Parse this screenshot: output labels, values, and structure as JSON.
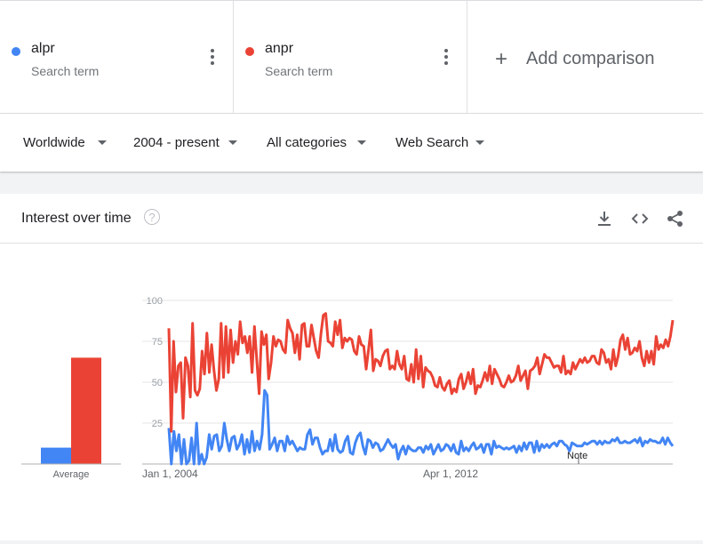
{
  "terms": [
    {
      "name": "alpr",
      "sub": "Search term",
      "color": "#4285f4"
    },
    {
      "name": "anpr",
      "sub": "Search term",
      "color": "#ea4335"
    }
  ],
  "add_comparison": "Add comparison",
  "filters": {
    "region": "Worldwide",
    "time": "2004 - present",
    "category": "All categories",
    "search_type": "Web Search"
  },
  "card": {
    "title": "Interest over time"
  },
  "chart_data": {
    "type": "line",
    "x_ticks": [
      "Jan 1, 2004",
      "Apr 1, 2012"
    ],
    "y_ticks": [
      25,
      50,
      75,
      100
    ],
    "ylim": [
      0,
      100
    ],
    "note_label": "Note",
    "average_label": "Average",
    "averages": [
      10,
      65
    ],
    "series": [
      {
        "name": "alpr",
        "color": "#4285f4",
        "values": [
          22,
          0,
          20,
          8,
          18,
          0,
          15,
          0,
          2,
          16,
          0,
          25,
          0,
          6,
          0,
          4,
          18,
          9,
          17,
          18,
          8,
          11,
          25,
          15,
          8,
          16,
          17,
          9,
          12,
          18,
          6,
          15,
          7,
          20,
          8,
          14,
          9,
          18,
          45,
          42,
          9,
          12,
          16,
          8,
          14,
          14,
          8,
          17,
          12,
          14,
          11,
          8,
          10,
          9,
          9,
          18,
          21,
          12,
          16,
          16,
          10,
          6,
          8,
          8,
          15,
          8,
          18,
          9,
          7,
          8,
          14,
          17,
          7,
          6,
          13,
          17,
          19,
          11,
          6,
          15,
          14,
          10,
          13,
          12,
          8,
          9,
          12,
          15,
          12,
          10,
          12,
          3,
          8,
          11,
          6,
          11,
          9,
          8,
          8,
          10,
          10,
          7,
          11,
          9,
          12,
          6,
          9,
          12,
          8,
          9,
          12,
          11,
          8,
          12,
          7,
          6,
          14,
          8,
          10,
          8,
          11,
          13,
          9,
          10,
          12,
          7,
          12,
          12,
          6,
          14,
          10,
          11,
          10,
          9,
          10,
          9,
          10,
          11,
          7,
          11,
          8,
          13,
          9,
          13,
          13,
          7,
          14,
          8,
          12,
          10,
          12,
          10,
          12,
          13,
          11,
          14,
          14,
          12,
          11,
          8,
          13,
          12,
          11,
          11,
          11,
          13,
          12,
          13,
          14,
          14,
          12,
          14,
          12,
          14,
          13,
          13,
          15,
          14,
          16,
          13,
          13,
          14,
          13,
          13,
          14,
          15,
          13,
          16,
          11,
          14,
          13,
          15,
          14,
          14,
          13,
          13,
          16,
          12,
          16,
          13,
          11
        ]
      },
      {
        "name": "anpr",
        "color": "#ea4335",
        "values": [
          83,
          20,
          75,
          44,
          60,
          62,
          28,
          65,
          60,
          41,
          86,
          45,
          42,
          46,
          69,
          55,
          80,
          56,
          73,
          57,
          45,
          52,
          86,
          53,
          84,
          56,
          82,
          62,
          75,
          67,
          87,
          74,
          78,
          68,
          78,
          56,
          84,
          63,
          43,
          81,
          73,
          79,
          52,
          62,
          78,
          72,
          76,
          75,
          70,
          68,
          88,
          83,
          80,
          68,
          79,
          64,
          85,
          86,
          72,
          72,
          85,
          77,
          69,
          65,
          80,
          91,
          92,
          75,
          74,
          72,
          87,
          79,
          88,
          71,
          77,
          75,
          77,
          76,
          69,
          67,
          78,
          73,
          72,
          58,
          70,
          82,
          57,
          64,
          63,
          60,
          66,
          69,
          70,
          58,
          60,
          58,
          69,
          61,
          58,
          66,
          52,
          51,
          61,
          50,
          70,
          52,
          66,
          47,
          59,
          57,
          56,
          53,
          48,
          47,
          53,
          47,
          45,
          49,
          51,
          43,
          46,
          44,
          52,
          55,
          46,
          50,
          56,
          49,
          58,
          43,
          48,
          47,
          51,
          56,
          51,
          60,
          49,
          58,
          55,
          52,
          48,
          47,
          50,
          54,
          50,
          51,
          54,
          60,
          51,
          54,
          57,
          46,
          57,
          58,
          60,
          65,
          55,
          61,
          67,
          65,
          65,
          62,
          59,
          60,
          60,
          56,
          66,
          55,
          57,
          55,
          62,
          58,
          61,
          64,
          62,
          65,
          62,
          63,
          66,
          66,
          62,
          61,
          70,
          68,
          62,
          64,
          58,
          70,
          60,
          66,
          76,
          79,
          70,
          77,
          67,
          68,
          71,
          69,
          75,
          65,
          60,
          69,
          62,
          69,
          61,
          78,
          70,
          73,
          71,
          76,
          72,
          78,
          88
        ]
      }
    ]
  }
}
